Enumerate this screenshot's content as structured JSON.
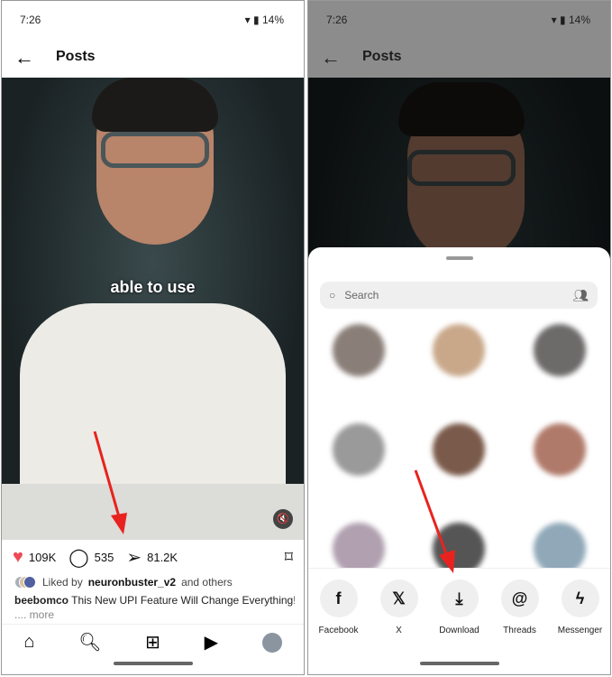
{
  "status": {
    "time": "7:26",
    "battery": "14%"
  },
  "left": {
    "header": {
      "title": "Posts"
    },
    "video": {
      "caption": "able to use"
    },
    "actions": {
      "likes": "109K",
      "comments": "535",
      "shares": "81.2K"
    },
    "liked_by": {
      "prefix": "Liked by",
      "user": "neuronbuster_v2",
      "suffix": "and others"
    },
    "post": {
      "author": "beebomco",
      "text": "This New UPI Feature Will Change Everything! 🤯",
      "more": ".... more"
    },
    "nav": [
      "home-icon",
      "search-icon",
      "create-icon",
      "reels-icon",
      "profile-icon"
    ]
  },
  "right": {
    "header": {
      "title": "Posts"
    },
    "search": {
      "placeholder": "Search"
    },
    "contacts_blurred": 9,
    "share_targets": [
      {
        "label": "Facebook",
        "icon": "facebook-icon",
        "glyph": "f"
      },
      {
        "label": "X",
        "icon": "x-icon",
        "glyph": "𝕏"
      },
      {
        "label": "Download",
        "icon": "download-icon",
        "glyph": "⤓"
      },
      {
        "label": "Threads",
        "icon": "threads-icon",
        "glyph": "@"
      },
      {
        "label": "Messenger",
        "icon": "messenger-icon",
        "glyph": "ϟ"
      }
    ]
  },
  "colors": {
    "like": "#ed4956",
    "annotation_arrow": "#e8231f"
  }
}
